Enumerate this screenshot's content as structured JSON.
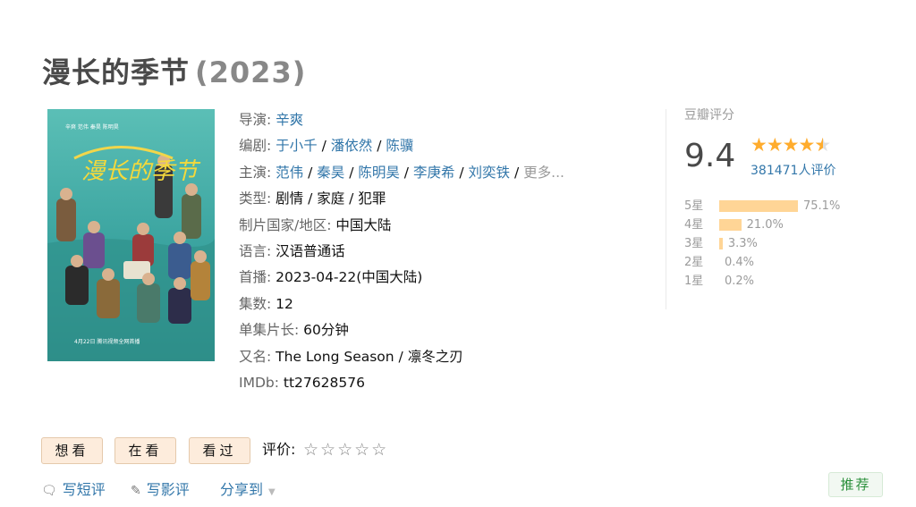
{
  "movie": {
    "title": "漫长的季节",
    "year": "(2023)"
  },
  "poster": {
    "credits_top": "辛爽 范伟 秦昊 陈明昊",
    "big_title": "漫长的季节",
    "bottom_text": "4月22日 腾讯视频全网首播",
    "bg_color": "#3fa7a3"
  },
  "info": {
    "director_label": "导演",
    "director": "辛爽",
    "writer_label": "编剧",
    "writers": [
      "于小千",
      "潘依然",
      "陈骥"
    ],
    "cast_label": "主演",
    "cast": [
      "范伟",
      "秦昊",
      "陈明昊",
      "李庚希",
      "刘奕铁"
    ],
    "cast_more": "更多...",
    "genre_label": "类型:",
    "genre": "剧情 / 家庭 / 犯罪",
    "country_label": "制片国家/地区:",
    "country": "中国大陆",
    "language_label": "语言:",
    "language": "汉语普通话",
    "premiere_label": "首播:",
    "premiere": "2023-04-22(中国大陆)",
    "episodes_label": "集数:",
    "episodes": "12",
    "runtime_label": "单集片长:",
    "runtime": "60分钟",
    "aka_label": "又名:",
    "aka": "The Long Season / 凛冬之刃",
    "imdb_label": "IMDb:",
    "imdb": "tt27628576"
  },
  "rating": {
    "label": "豆瓣评分",
    "score": "9.4",
    "stars": 4.5,
    "votes": "381471人评价",
    "distribution": [
      {
        "label": "5星",
        "percent": 75.1,
        "text": "75.1%"
      },
      {
        "label": "4星",
        "percent": 21.0,
        "text": "21.0%"
      },
      {
        "label": "3星",
        "percent": 3.3,
        "text": "3.3%"
      },
      {
        "label": "2星",
        "percent": 0.4,
        "text": "0.4%"
      },
      {
        "label": "1星",
        "percent": 0.2,
        "text": "0.2%"
      }
    ]
  },
  "actions": {
    "want": "想看",
    "watching": "在看",
    "watched": "看过",
    "rate_label": "评价:",
    "rate_stars": "☆☆☆☆☆"
  },
  "links": {
    "short_review": "写短评",
    "review": "写影评",
    "share": "分享到",
    "short_review_icon": "speech-bubble-icon",
    "review_icon": "pencil-icon"
  },
  "recommend": "推荐",
  "colors": {
    "link": "#3377aa",
    "star": "#ffac2d",
    "bar": "#ffd596",
    "button_bg": "#fdecdc"
  }
}
